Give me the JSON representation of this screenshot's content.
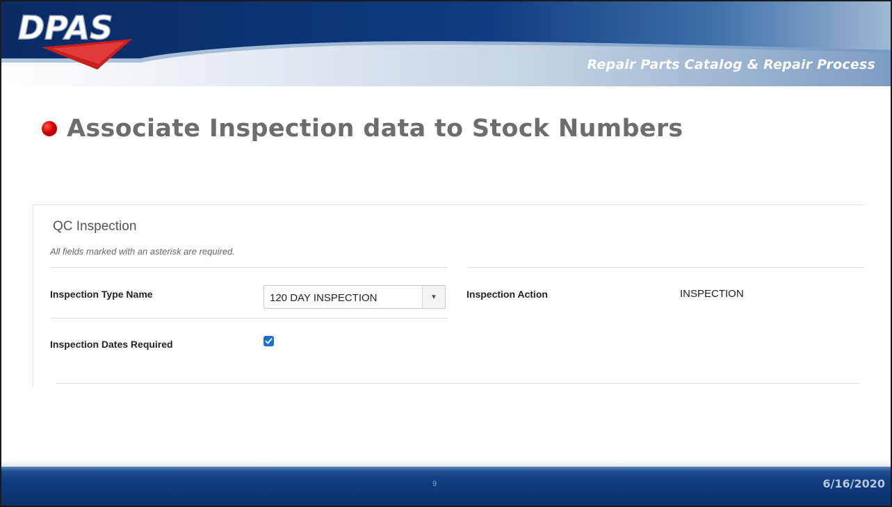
{
  "header": {
    "logo_text": "DPAS",
    "subtitle": "Repair Parts Catalog & Repair Process"
  },
  "slide": {
    "headline": "Associate Inspection data to Stock Numbers"
  },
  "qc_inspection": {
    "title": "QC Inspection",
    "required_note": "All fields marked with an asterisk are required.",
    "inspection_type": {
      "label": "Inspection Type Name",
      "value": "120 DAY INSPECTION"
    },
    "inspection_action": {
      "label": "Inspection Action",
      "value": "INSPECTION"
    },
    "inspection_dates_required": {
      "label": "Inspection Dates Required",
      "checked": true
    }
  },
  "footer": {
    "page_number": "9",
    "date": "6/16/2020"
  },
  "colors": {
    "banner_dark": "#0b2f6b",
    "banner_light": "#c9d6e6",
    "bullet_red": "#d40000",
    "headline_gray": "#6d6d6d",
    "checkbox_blue": "#1b6fd6",
    "footer_blue": "#0f3c7e"
  },
  "icons": {
    "select_arrow": "triangle-down-icon",
    "checkbox": "checkmark-icon"
  }
}
